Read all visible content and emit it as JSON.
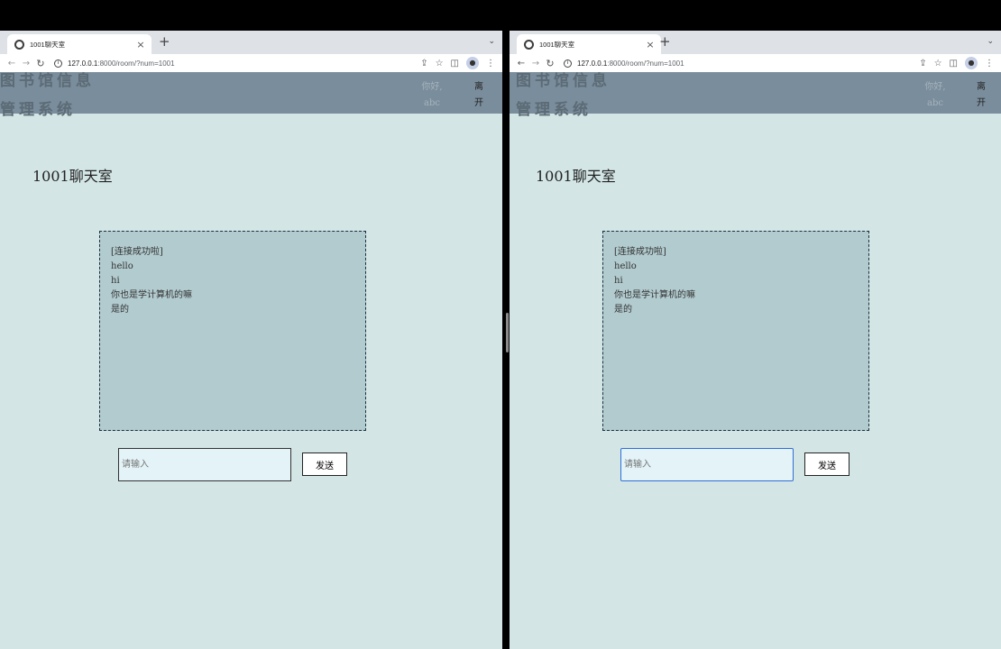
{
  "browser": {
    "tab_title": "1001聊天室",
    "tab_close": "×",
    "new_tab": "+",
    "tab_menu": "⌄",
    "url_host": "127.0.0.1",
    "url_path": ":8000/room/?num=1001"
  },
  "site": {
    "brand_line1": "图书馆信息",
    "brand_line2": "管理系统",
    "greeting_line1": "你好,",
    "greeting_line2": "abc",
    "leave_line1": "离",
    "leave_line2": "开"
  },
  "room": {
    "title": "1001聊天室",
    "messages": [
      "[连接成功啦]",
      "hello",
      "hi",
      "你也是学计算机的嘛",
      "是的"
    ],
    "input_placeholder": "请输入",
    "send_label": "发送"
  },
  "icons": {
    "back": "back-arrow-icon",
    "forward": "forward-arrow-icon",
    "reload": "reload-icon",
    "info": "site-info-icon",
    "share": "share-icon",
    "star": "bookmark-star-icon",
    "sidepanel": "side-panel-icon",
    "profile": "profile-icon",
    "menu": "kebab-menu-icon"
  }
}
